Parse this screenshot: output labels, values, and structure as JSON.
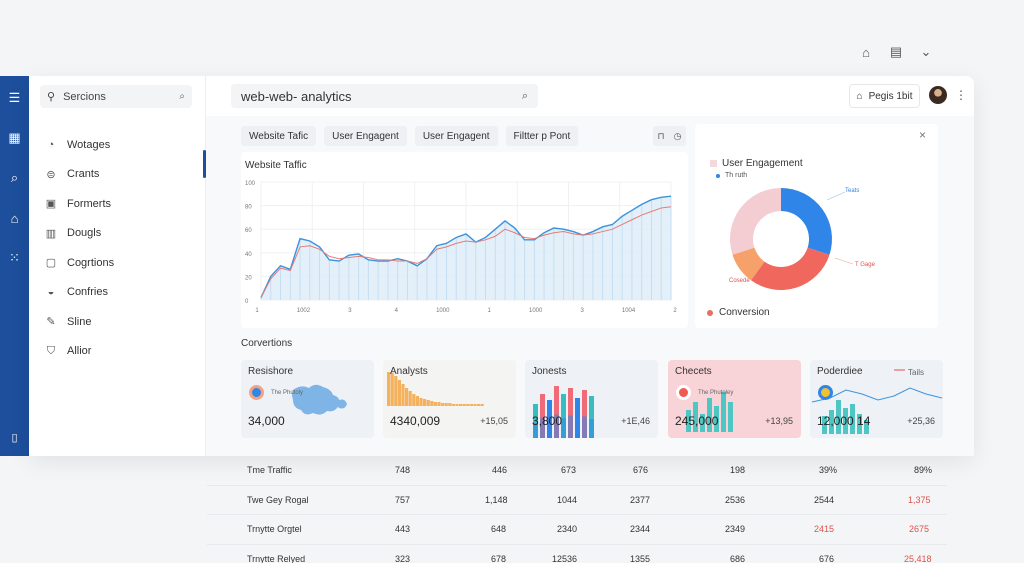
{
  "top_bar": {
    "icons": [
      "home-icon",
      "document-icon",
      "chevron-down-icon"
    ]
  },
  "rail": {
    "icons": [
      "menu-icon",
      "dashboard-icon",
      "search-icon",
      "alerts-icon",
      "apps-icon",
      "settings-icon"
    ]
  },
  "sidebar": {
    "search_label": "Sercions",
    "items": [
      {
        "label": "Wotages",
        "icon": "chart-icon"
      },
      {
        "label": "Crants",
        "icon": "stack-icon"
      },
      {
        "label": "Formerts",
        "icon": "form-icon"
      },
      {
        "label": "Dougls",
        "icon": "document-icon"
      },
      {
        "label": "Cogrtions",
        "icon": "square-icon"
      },
      {
        "label": "Confries",
        "icon": "gauge-icon"
      },
      {
        "label": "Sline",
        "icon": "pen-icon"
      },
      {
        "label": "Allior",
        "icon": "shield-icon"
      }
    ]
  },
  "header": {
    "search_value": "web-web- analytics",
    "page_button": "Pegis 1bit"
  },
  "filters": [
    "Website Tafic",
    "User Engagent",
    "User Engagent",
    "Filtter p Pont"
  ],
  "traffic": {
    "title": "Website Taffic",
    "yticks": [
      "100",
      "80",
      "60",
      "40",
      "20",
      "0"
    ],
    "xticks": [
      "1",
      "1002",
      "3",
      "4",
      "1000",
      "1",
      "1000",
      "3",
      "1004",
      "2"
    ]
  },
  "engagement": {
    "title": "User Engagement",
    "legend": "Th ruth",
    "conversion_label": "Conversion",
    "slice_labels": [
      "Teats",
      "T Gage",
      "Cosede"
    ]
  },
  "conversions_heading": "Corvertions",
  "stats": [
    {
      "title": "Resishore",
      "value": "34,000",
      "delta": "",
      "sub": "The Phutoly"
    },
    {
      "title": "Analysts",
      "value": "4340,009",
      "delta": "+15,05",
      "sub": ""
    },
    {
      "title": "Jonests",
      "value": "3,800",
      "delta": "+1E,46",
      "sub": ""
    },
    {
      "title": "Checets",
      "value": "245,000",
      "delta": "+13,95",
      "sub": "The Phutoley"
    },
    {
      "title": "Poderdiee",
      "value": "12,000 14",
      "delta": "+25,36",
      "sub": "Tails"
    }
  ],
  "table": {
    "rows": [
      {
        "name": "Tme Traffic",
        "cells": [
          "748",
          "446",
          "673",
          "676",
          "198",
          "39%",
          "89%"
        ],
        "red": [
          false,
          false,
          false,
          false,
          false,
          false,
          false
        ]
      },
      {
        "name": "Twe Gey Rogal",
        "cells": [
          "757",
          "1,148",
          "1044",
          "2377",
          "2536",
          "2544",
          "1,375"
        ],
        "red": [
          false,
          false,
          false,
          false,
          false,
          false,
          true
        ]
      },
      {
        "name": "Trnytte Orgtel",
        "cells": [
          "443",
          "648",
          "2340",
          "2344",
          "2349",
          "2415",
          "2675"
        ],
        "red": [
          false,
          false,
          false,
          false,
          false,
          true,
          true
        ]
      },
      {
        "name": "Trnytte Relyed",
        "cells": [
          "323",
          "678",
          "12536",
          "1355",
          "686",
          "676",
          "25,418"
        ],
        "red": [
          false,
          false,
          false,
          false,
          false,
          false,
          true
        ]
      }
    ]
  },
  "chart_data": [
    {
      "type": "line",
      "title": "Website Taffic",
      "x": [
        0,
        1,
        2,
        3,
        4,
        5,
        6,
        7,
        8,
        9,
        10,
        11,
        12,
        13,
        14,
        15,
        16,
        17,
        18,
        19,
        20,
        21,
        22,
        23,
        24,
        25,
        26,
        27,
        28,
        29,
        30,
        31,
        32,
        33,
        34,
        35,
        36,
        37,
        38,
        39,
        40,
        41,
        42
      ],
      "ylim": [
        0,
        100
      ],
      "series": [
        {
          "values": [
            2,
            20,
            29,
            26,
            52,
            50,
            45,
            34,
            33,
            38,
            39,
            34,
            33,
            33,
            35,
            33,
            29,
            35,
            46,
            48,
            53,
            56,
            49,
            53,
            60,
            67,
            61,
            51,
            51,
            57,
            61,
            60,
            58,
            55,
            58,
            62,
            64,
            71,
            76,
            81,
            85,
            87,
            88
          ]
        },
        {
          "values": [
            2,
            18,
            27,
            25,
            45,
            46,
            43,
            37,
            35,
            36,
            37,
            36,
            34,
            34,
            33,
            33,
            31,
            35,
            43,
            45,
            48,
            50,
            49,
            51,
            54,
            60,
            57,
            53,
            52,
            55,
            57,
            58,
            56,
            55,
            56,
            58,
            60,
            64,
            68,
            72,
            75,
            78,
            79
          ]
        }
      ],
      "grid": true
    },
    {
      "type": "pie",
      "title": "User Engagement",
      "labels": [
        "Teats",
        "T Gage",
        "Cosede",
        ""
      ],
      "values": [
        30,
        30,
        10,
        30
      ],
      "colors": [
        "#2f86e8",
        "#f0675d",
        "#f6a06a",
        "#f3cdd2"
      ]
    }
  ]
}
